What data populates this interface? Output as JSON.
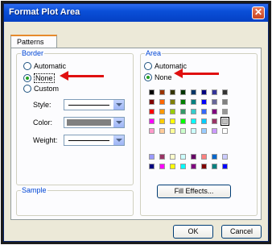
{
  "window": {
    "title": "Format Plot Area",
    "close_glyph": "✕"
  },
  "tabs": [
    {
      "label": "Patterns"
    }
  ],
  "border_group": {
    "label": "Border",
    "options": [
      {
        "label": "Automatic",
        "selected": false
      },
      {
        "label": "None",
        "selected": true
      },
      {
        "label": "Custom",
        "selected": false
      }
    ],
    "fields": {
      "style_label": "Style:",
      "color_label": "Color:",
      "weight_label": "Weight:",
      "color_value": "#808080"
    }
  },
  "sample_group": {
    "label": "Sample"
  },
  "area_group": {
    "label": "Area",
    "options": [
      {
        "label": "Automatic",
        "selected": false
      },
      {
        "label": "None",
        "selected": true
      }
    ],
    "palette_main": [
      [
        "#000000",
        "#993300",
        "#333300",
        "#003300",
        "#003366",
        "#000080",
        "#333399",
        "#333333"
      ],
      [
        "#800000",
        "#ff6600",
        "#808000",
        "#008000",
        "#008080",
        "#0000ff",
        "#666699",
        "#808080"
      ],
      [
        "#ff0000",
        "#ff9900",
        "#99cc00",
        "#339966",
        "#33cccc",
        "#3366ff",
        "#800080",
        "#969696"
      ],
      [
        "#ff00ff",
        "#ffcc00",
        "#ffff00",
        "#00ff00",
        "#00ffff",
        "#00ccff",
        "#993366",
        "#c0c0c0"
      ],
      [
        "#ff99cc",
        "#ffcc99",
        "#ffff99",
        "#ccffcc",
        "#ccffff",
        "#99ccff",
        "#cc99ff",
        "#ffffff"
      ]
    ],
    "palette_chart": [
      [
        "#9999ff",
        "#993366",
        "#ffffcc",
        "#ccffff",
        "#660066",
        "#ff8080",
        "#0066cc",
        "#ccccff"
      ],
      [
        "#000080",
        "#ff00ff",
        "#ffff00",
        "#00ffff",
        "#800080",
        "#800000",
        "#008080",
        "#0000ff"
      ]
    ],
    "selected_swatch": "3-7",
    "fill_effects_label": "Fill Effects..."
  },
  "footer": {
    "ok_label": "OK",
    "cancel_label": "Cancel"
  },
  "annotations": {
    "arrow_color": "#e01010"
  }
}
